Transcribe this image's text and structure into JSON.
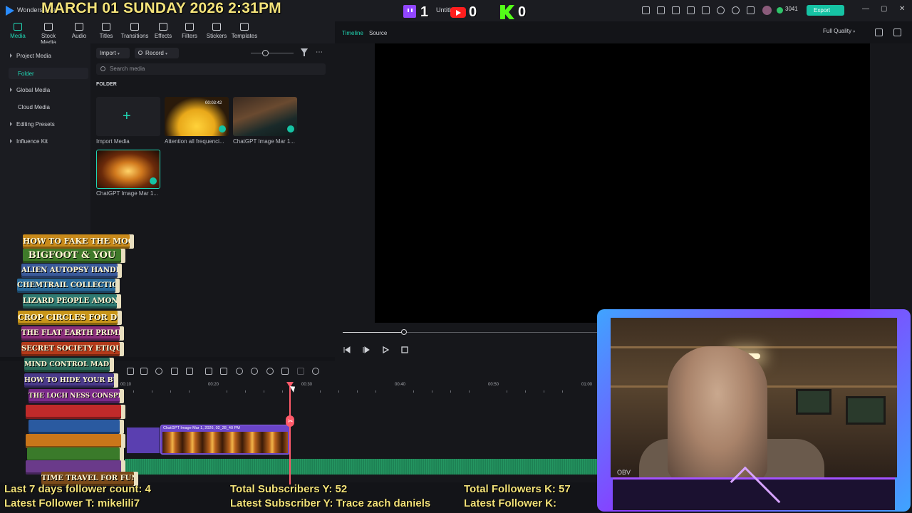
{
  "app": {
    "name": "Wondershare",
    "project": "Untitl"
  },
  "overlay": {
    "clock": "MARCH 01 SUNDAY 2026 2:31PM",
    "twitch_count": "1",
    "youtube_count": "0",
    "kick_count": "0",
    "coins": "3041",
    "export_label": "Export"
  },
  "toolbar": {
    "items": [
      {
        "label": "Media",
        "icon": "media-icon"
      },
      {
        "label": "Stock Media",
        "icon": "stock-media-icon"
      },
      {
        "label": "Audio",
        "icon": "audio-icon"
      },
      {
        "label": "Titles",
        "icon": "titles-icon"
      },
      {
        "label": "Transitions",
        "icon": "transitions-icon"
      },
      {
        "label": "Effects",
        "icon": "effects-icon"
      },
      {
        "label": "Filters",
        "icon": "filters-icon"
      },
      {
        "label": "Stickers",
        "icon": "stickers-icon"
      },
      {
        "label": "Templates",
        "icon": "templates-icon"
      }
    ]
  },
  "sidebar": {
    "items": [
      "Project Media",
      "Folder",
      "Global Media",
      "Cloud Media",
      "Editing Presets",
      "Influence Kit"
    ]
  },
  "media": {
    "import_label": "Import",
    "record_label": "Record",
    "search_placeholder": "Search media",
    "folder_heading": "FOLDER",
    "tiles": [
      {
        "label": "Import Media"
      },
      {
        "label": "Attention all frequenci...",
        "duration": "00:03:42"
      },
      {
        "label": "ChatGPT Image Mar 1..."
      },
      {
        "label": "ChatGPT Image Mar 1..."
      }
    ]
  },
  "player": {
    "tab_timeline": "Timeline",
    "tab_source": "Source",
    "quality": "Full Quality"
  },
  "timeline": {
    "ruler": [
      "00:10",
      "00:20",
      "00:30",
      "00:40",
      "00:50",
      "01:00"
    ],
    "clip_label": "ChatGPT Image Mar 1, 2026, 02_28_40 PM"
  },
  "books": [
    "HOW TO FAKE THE MOON LANDING",
    "BIGFOOT & YOU",
    "ALIEN AUTOPSY HANDBOOK",
    "CHEMTRAIL COLLECTION GUIDE",
    "LIZARD PEOPLE AMONG US",
    "CROP CIRCLES FOR DUMMIES",
    "THE FLAT EARTH PRIMER",
    "SECRET SOCIETY ETIQUETTE",
    "MIND CONTROL MADE EASY",
    "HOW TO HIDE YOUR BUNKER",
    "THE LOCH NESS CONSPIRACY",
    "",
    "",
    "",
    "",
    "",
    "TIME TRAVEL FOR FUN & PROFIT"
  ],
  "webcam": {
    "tag": "OBV"
  },
  "stats": {
    "follower_count": "Last 7 days follower count: 4",
    "latest_follower_t": "Latest Follower T: mikelili7",
    "total_subs_y": "Total Subscribers Y: 52",
    "latest_sub_y": "Latest Subscriber Y: Trace zach daniels",
    "total_followers_k": "Total Followers K: 57",
    "latest_follower_k": "Latest Follower K:"
  },
  "colors": {
    "accent": "#20d7b4",
    "overlay_text": "#f3e27a",
    "clip": "#6a44c8",
    "playhead": "#ff5a6a"
  }
}
